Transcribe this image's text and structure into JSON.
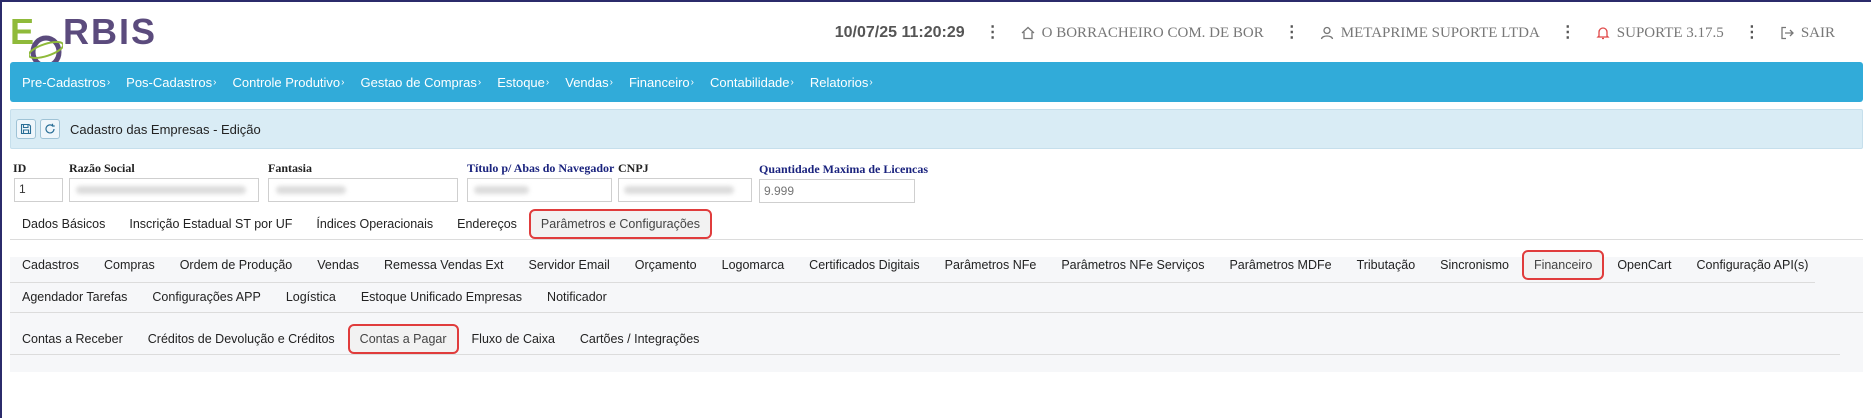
{
  "logo": {
    "first": "E",
    "rest": "RBIS"
  },
  "header": {
    "datetime": "10/07/25 11:20:29",
    "company": "O BORRACHEIRO COM. DE BOR",
    "user_company": "METAPRIME SUPORTE LTDA",
    "support": "SUPORTE 3.17.5",
    "logout": "SAIR",
    "icons": [
      "home-icon",
      "user-icon",
      "bell-icon",
      "logout-icon"
    ]
  },
  "nav": {
    "items": [
      "Pre-Cadastros",
      "Pos-Cadastros",
      "Controle Produtivo",
      "Gestao de Compras",
      "Estoque",
      "Vendas",
      "Financeiro",
      "Contabilidade",
      "Relatorios"
    ],
    "chevron": "›"
  },
  "title": {
    "icons": [
      "save-icon",
      "refresh-icon"
    ],
    "text": "Cadastro das Empresas - Edição"
  },
  "form": {
    "id_label": "ID",
    "id_value": "1",
    "razao_label": "Razão Social",
    "fantasia_label": "Fantasia",
    "titulo_label": "Título p/ Abas do Navegador",
    "cnpj_label": "CNPJ",
    "licencas_label": "Quantidade Maxima de Licencas",
    "licencas_placeholder": "9.999"
  },
  "tabs_main": [
    "Dados Básicos",
    "Inscrição Estadual ST por UF",
    "Índices Operacionais",
    "Endereços",
    "Parâmetros e Configurações"
  ],
  "tabs_main_selected": "Parâmetros e Configurações",
  "tabs_params_row1": [
    "Cadastros",
    "Compras",
    "Ordem de Produção",
    "Vendas",
    "Remessa Vendas Ext",
    "Servidor Email",
    "Orçamento",
    "Logomarca",
    "Certificados Digitais",
    "Parâmetros NFe",
    "Parâmetros NFe Serviços",
    "Parâmetros MDFe",
    "Tributação",
    "Sincronismo",
    "Financeiro",
    "OpenCart",
    "Configuração API(s)"
  ],
  "tabs_params_row2": [
    "Agendador Tarefas",
    "Configurações APP",
    "Logística",
    "Estoque Unificado Empresas",
    "Notificador"
  ],
  "tabs_params_selected": "Financeiro",
  "tabs_fin": [
    "Contas a Receber",
    "Créditos de Devolução e Créditos",
    "Contas a Pagar",
    "Fluxo de Caixa",
    "Cartões / Integrações"
  ],
  "tabs_fin_selected": "Contas a Pagar"
}
